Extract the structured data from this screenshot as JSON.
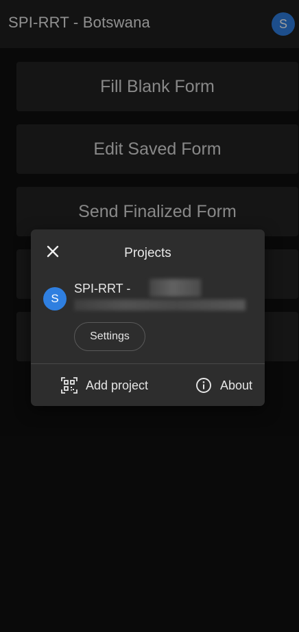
{
  "appbar": {
    "title": "SPI-RRT - Botswana",
    "avatar_letter": "S"
  },
  "main_menu": [
    {
      "label": "Fill Blank Form"
    },
    {
      "label": "Edit Saved Form"
    },
    {
      "label": "Send Finalized Form"
    },
    {
      "label": ""
    },
    {
      "label": ""
    }
  ],
  "dialog": {
    "title": "Projects",
    "close_icon": "close-icon",
    "project": {
      "avatar_letter": "S",
      "name": "SPI-RRT -"
    },
    "settings_label": "Settings",
    "add_project_label": "Add project",
    "about_label": "About"
  },
  "colors": {
    "background": "#101010",
    "appbar": "#1f1f1f",
    "menu_button": "#232323",
    "dialog": "#2d2d2d",
    "accent_avatar": "#2f7fe0",
    "text": "#e6e6e6"
  }
}
